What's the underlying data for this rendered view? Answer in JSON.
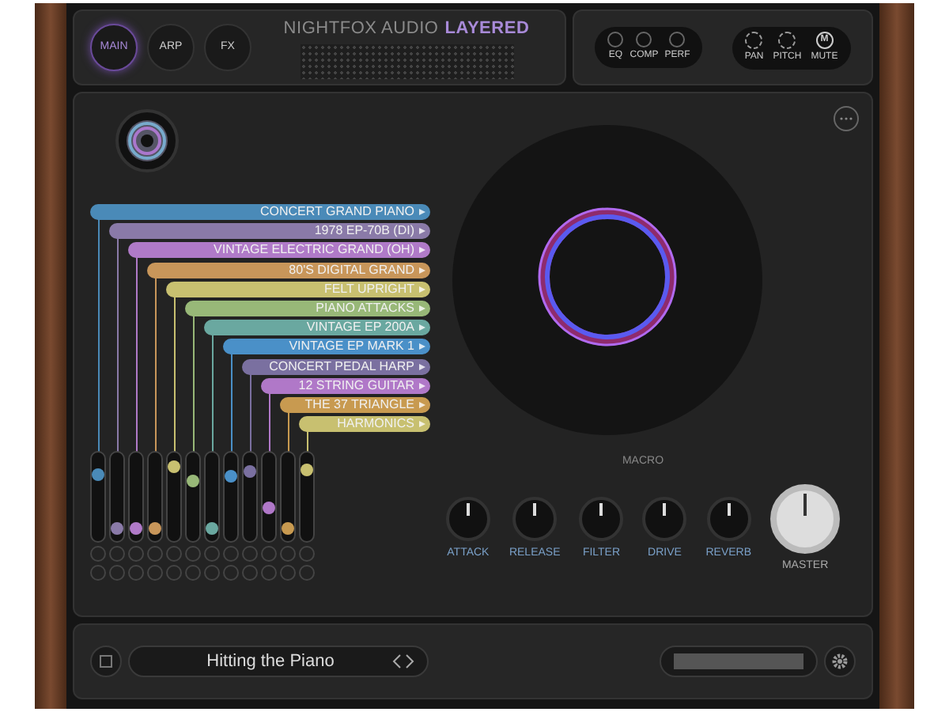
{
  "header": {
    "tabs": [
      {
        "label": "MAIN",
        "selected": true
      },
      {
        "label": "ARP",
        "selected": false
      },
      {
        "label": "FX",
        "selected": false
      }
    ],
    "brand": "NIGHTFOX AUDIO",
    "product": "LAYERED",
    "fx_buttons": [
      "EQ",
      "COMP",
      "PERF"
    ],
    "mix_controls": [
      {
        "label": "PAN",
        "kind": "knob"
      },
      {
        "label": "PITCH",
        "kind": "knob"
      },
      {
        "label": "MUTE",
        "kind": "toggle",
        "glyph": "M"
      }
    ]
  },
  "layers": [
    {
      "name": "CONCERT GRAND PIANO",
      "color": "#4a8ab8",
      "level": 0.8
    },
    {
      "name": "1978 EP-70B (DI)",
      "color": "#8a7aa8",
      "level": 0.08
    },
    {
      "name": "VINTAGE ELECTRIC GRAND (OH)",
      "color": "#b07ac8",
      "level": 0.08
    },
    {
      "name": "80'S DIGITAL GRAND",
      "color": "#c8965a",
      "level": 0.08
    },
    {
      "name": "FELT UPRIGHT",
      "color": "#c8c070",
      "level": 0.9
    },
    {
      "name": "PIANO ATTACKS",
      "color": "#98b878",
      "level": 0.7
    },
    {
      "name": "VINTAGE EP 200A",
      "color": "#6aa8a0",
      "level": 0.08
    },
    {
      "name": "VINTAGE EP MARK 1",
      "color": "#4a90c8",
      "level": 0.78
    },
    {
      "name": "CONCERT PEDAL HARP",
      "color": "#7a70a0",
      "level": 0.84
    },
    {
      "name": "12 STRING GUITAR",
      "color": "#b078c8",
      "level": 0.35
    },
    {
      "name": "THE 37 TRIANGLE",
      "color": "#c89a50",
      "level": 0.08
    },
    {
      "name": "HARMONICS",
      "color": "#c8c070",
      "level": 0.86
    }
  ],
  "macro": {
    "title": "MACRO",
    "knobs": [
      {
        "label": "ATTACK"
      },
      {
        "label": "RELEASE"
      },
      {
        "label": "FILTER"
      },
      {
        "label": "DRIVE"
      },
      {
        "label": "REVERB"
      }
    ],
    "master": {
      "label": "MASTER"
    }
  },
  "footer": {
    "preset": "Hitting the Piano"
  }
}
